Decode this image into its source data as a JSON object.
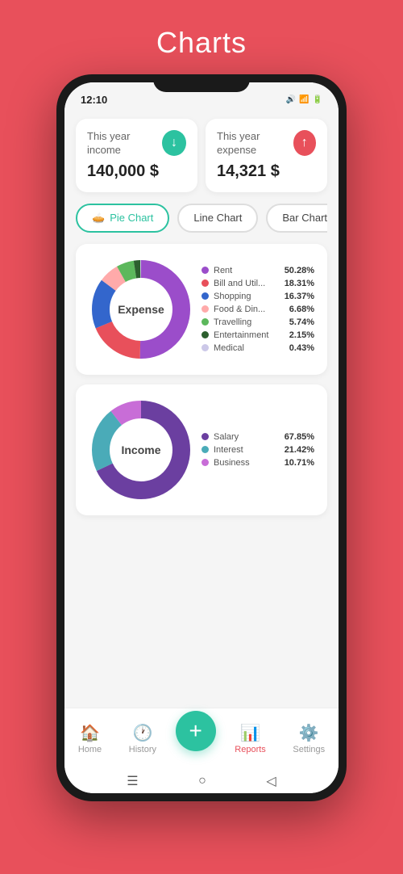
{
  "page": {
    "title": "Charts",
    "bg_color": "#E8505B"
  },
  "status_bar": {
    "time": "12:10",
    "icons": "🔊 📶 🔋"
  },
  "summary": {
    "income_card": {
      "title": "This year income",
      "amount": "140,000 $",
      "icon": "↓",
      "icon_color": "#2CC2A0"
    },
    "expense_card": {
      "title": "This year expense",
      "amount": "14,321 $",
      "icon": "↑",
      "icon_color": "#E8505B"
    }
  },
  "tabs": [
    {
      "label": "Pie Chart",
      "active": true
    },
    {
      "label": "Line Chart",
      "active": false
    },
    {
      "label": "Bar Chart",
      "active": false
    }
  ],
  "expense_chart": {
    "center_label": "Expense",
    "legend": [
      {
        "name": "Rent",
        "pct": "50.28%",
        "color": "#9B4DCA"
      },
      {
        "name": "Bill and Util...",
        "pct": "18.31%",
        "color": "#E8505B"
      },
      {
        "name": "Shopping",
        "pct": "16.37%",
        "color": "#3366CC"
      },
      {
        "name": "Food & Din...",
        "pct": "6.68%",
        "color": "#FFAAAA"
      },
      {
        "name": "Travelling",
        "pct": "5.74%",
        "color": "#5CB85C"
      },
      {
        "name": "Entertainment",
        "pct": "2.15%",
        "color": "#2C5F2E"
      },
      {
        "name": "Medical",
        "pct": "0.43%",
        "color": "#CCC8E8"
      }
    ],
    "segments": [
      {
        "color": "#9B4DCA",
        "pct": 50.28
      },
      {
        "color": "#E8505B",
        "pct": 18.31
      },
      {
        "color": "#3366CC",
        "pct": 16.37
      },
      {
        "color": "#FFAAAA",
        "pct": 6.68
      },
      {
        "color": "#5CB85C",
        "pct": 5.74
      },
      {
        "color": "#2C5F2E",
        "pct": 2.15
      },
      {
        "color": "#CCC8E8",
        "pct": 0.43
      }
    ]
  },
  "income_chart": {
    "center_label": "Income",
    "legend": [
      {
        "name": "Salary",
        "pct": "67.85%",
        "color": "#6B3FA0"
      },
      {
        "name": "Interest",
        "pct": "21.42%",
        "color": "#4AABB8"
      },
      {
        "name": "Business",
        "pct": "10.71%",
        "color": "#C86DD7"
      }
    ],
    "segments": [
      {
        "color": "#6B3FA0",
        "pct": 67.85
      },
      {
        "color": "#4AABB8",
        "pct": 21.42
      },
      {
        "color": "#C86DD7",
        "pct": 10.71
      }
    ]
  },
  "bottom_nav": {
    "items": [
      {
        "label": "Home",
        "icon": "🏠",
        "active": false
      },
      {
        "label": "History",
        "icon": "🕐",
        "active": false
      },
      {
        "label": "+",
        "fab": true
      },
      {
        "label": "Reports",
        "icon": "📊",
        "active": true
      },
      {
        "label": "Settings",
        "icon": "⚙️",
        "active": false
      }
    ]
  }
}
